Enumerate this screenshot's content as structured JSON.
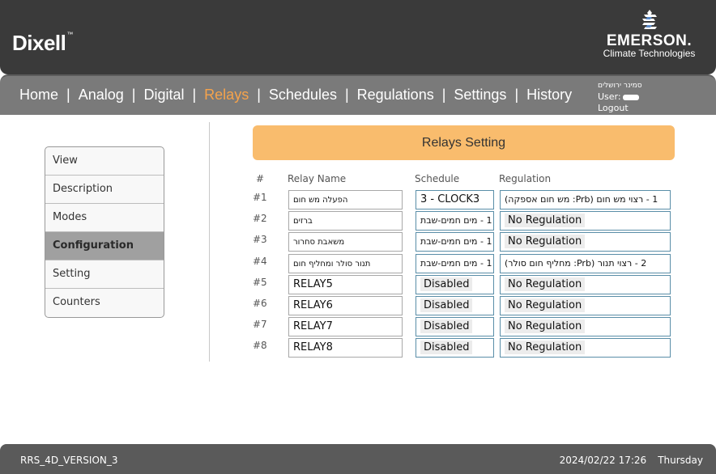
{
  "header": {
    "brand_left": "Dixell",
    "brand_left_tm": "™",
    "brand_right_name": "EMERSON",
    "brand_right_tm": ".",
    "brand_right_sub": "Climate Technologies"
  },
  "nav": {
    "items": [
      {
        "label": "Home"
      },
      {
        "label": "Analog"
      },
      {
        "label": "Digital"
      },
      {
        "label": "Relays",
        "active": true
      },
      {
        "label": "Schedules"
      },
      {
        "label": "Regulations"
      },
      {
        "label": "Settings"
      },
      {
        "label": "History"
      }
    ],
    "separator": "|",
    "site_name": "סמינר ירושלים",
    "user_label": "User:",
    "logout_label": "Logout",
    "active_color": "#f6a34b"
  },
  "sidebar": {
    "items": [
      {
        "label": "View"
      },
      {
        "label": "Description"
      },
      {
        "label": "Modes"
      },
      {
        "label": "Configuration",
        "active": true
      },
      {
        "label": "Setting"
      },
      {
        "label": "Counters"
      }
    ]
  },
  "main": {
    "title": "Relays Setting",
    "columns": {
      "num": "#",
      "name": "Relay Name",
      "schedule": "Schedule",
      "regulation": "Regulation"
    },
    "rows": [
      {
        "num": "#1",
        "name": "הפעלה מש חום",
        "schedule": "3 - CLOCK3",
        "regulation": "1 - רצוי מש חום (Prb: מש חום אספקה)"
      },
      {
        "num": "#2",
        "name": "ברזים",
        "schedule": "1 - מים חמים-שבת",
        "regulation": "No Regulation"
      },
      {
        "num": "#3",
        "name": "משאבת סחרור",
        "schedule": "1 - מים חמים-שבת",
        "regulation": "No Regulation"
      },
      {
        "num": "#4",
        "name": "תנור סולר ומחליף חום",
        "schedule": "1 - מים חמים-שבת",
        "regulation": "2 - רצוי תנור (Prb: מחליף חום סולר)"
      },
      {
        "num": "#5",
        "name": "RELAY5",
        "schedule": "Disabled",
        "regulation": "No Regulation"
      },
      {
        "num": "#6",
        "name": "RELAY6",
        "schedule": "Disabled",
        "regulation": "No Regulation"
      },
      {
        "num": "#7",
        "name": "RELAY7",
        "schedule": "Disabled",
        "regulation": "No Regulation"
      },
      {
        "num": "#8",
        "name": "RELAY8",
        "schedule": "Disabled",
        "regulation": "No Regulation"
      }
    ]
  },
  "footer": {
    "version": "RRS_4D_VERSION_3",
    "date": "2024/02/22 17:26",
    "weekday": "Thursday"
  },
  "colors": {
    "header_bg": "#3a3a3a",
    "nav_bg": "#7a7a7a",
    "banner_bg": "#f9bc6d",
    "footer_bg": "#5a5a5a"
  }
}
